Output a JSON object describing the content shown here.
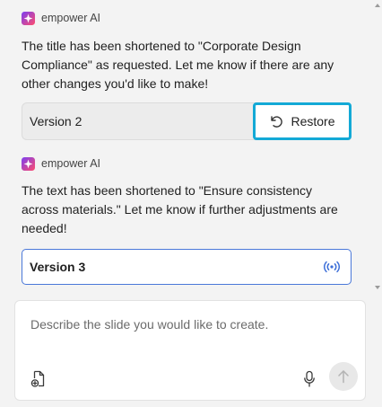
{
  "messages": [
    {
      "sender": "empower AI",
      "text": "The title has been shortened to \"Corporate Design Compliance\" as requested. Let me know if there are any other changes you'd like to make!",
      "version_label": "Version 2",
      "action_label": "Restore"
    },
    {
      "sender": "empower AI",
      "text": "The text has been shortened to \"Ensure consistency across materials.\" Let me know if further adjustments are needed!",
      "version_label": "Version 3"
    }
  ],
  "composer": {
    "placeholder": "Describe the slide you would like to create.",
    "value": ""
  },
  "icons": {
    "sender": "empower-sparkle-icon",
    "restore": "undo-arrow-icon",
    "live": "broadcast-icon",
    "attach": "add-file-icon",
    "mic": "microphone-icon",
    "send": "arrow-up-icon"
  },
  "colors": {
    "highlight": "#13a9d6",
    "active_border": "#4a78d9",
    "brand_gradient_start": "#7b3ff2",
    "brand_gradient_end": "#ff5a5f"
  }
}
